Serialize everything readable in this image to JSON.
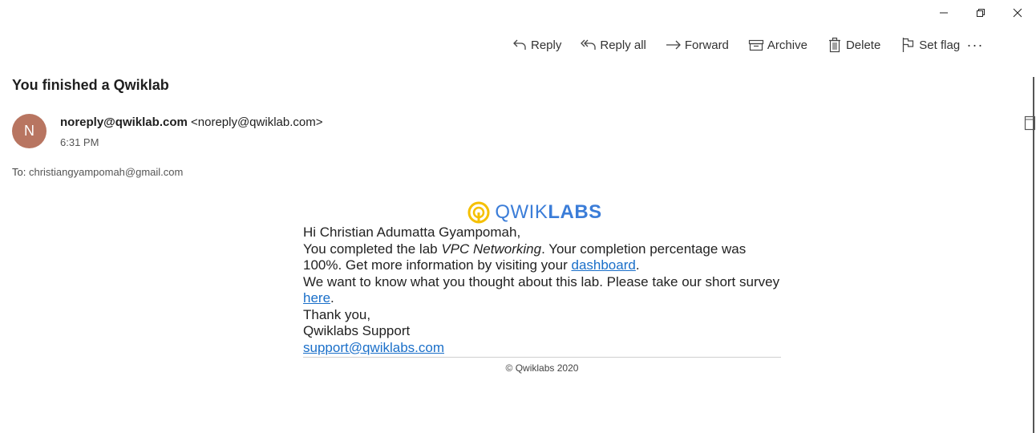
{
  "window": {
    "minimize_icon": "minimize-icon",
    "restore_icon": "restore-icon",
    "close_icon": "close-icon"
  },
  "toolbar": {
    "reply": "Reply",
    "reply_all": "Reply all",
    "forward": "Forward",
    "archive": "Archive",
    "delete": "Delete",
    "set_flag": "Set flag",
    "more": "···"
  },
  "message": {
    "subject": "You finished a Qwiklab",
    "avatar_initial": "N",
    "sender_name": "noreply@qwiklab.com",
    "sender_email": "<noreply@qwiklab.com>",
    "time": "6:31 PM",
    "to_label": "To:",
    "to_address": "christiangyampomah@gmail.com"
  },
  "email": {
    "logo_text_light": "QWIK",
    "logo_text_bold": "LABS",
    "greeting": "Hi Christian Adumatta Gyampomah,",
    "line1_pre": "You completed the lab ",
    "lab_name": "VPC Networking",
    "line1_post": ". Your completion percentage was 100%. Get more information by visiting your ",
    "dashboard_link": "dashboard",
    "period1": ".",
    "survey_pre": "We want to know what you thought about this lab. Please take our short survey ",
    "here_link": "here",
    "period2": ".",
    "thanks": "Thank you,",
    "signature": "Qwiklabs Support",
    "support_email": "support@qwiklabs.com",
    "copyright": "© Qwiklabs 2020"
  },
  "colors": {
    "avatar_bg": "#b87561",
    "link": "#1a6fc9",
    "logo_blue": "#3b7dd8",
    "logo_yellow": "#f5c000"
  }
}
